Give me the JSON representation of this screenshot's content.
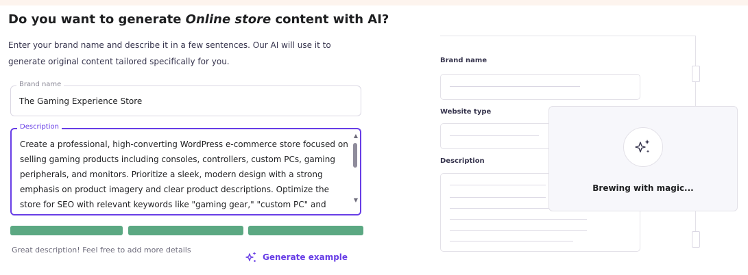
{
  "heading": {
    "prefix": "Do you want to generate ",
    "emphasis": "Online store",
    "suffix": " content with AI?"
  },
  "intro": "Enter your brand name and describe it in a few sentences. Our AI will use it to generate original content tailored specifically for you.",
  "form": {
    "brand": {
      "label": "Brand name",
      "value": "The Gaming Experience Store"
    },
    "description": {
      "label": "Description",
      "value": "Create a professional, high-converting WordPress e-commerce store focused on selling gaming products including consoles, controllers, custom PCs, gaming peripherals, and monitors. Prioritize a sleek, modern design with a strong emphasis on product imagery and clear product descriptions. Optimize the store for SEO with relevant keywords like \"gaming gear,\" \"custom PC\" and \"gaming accessories.\" Integrate a user-friendly shopping"
    },
    "quality_meter": {
      "filled_segments": 3,
      "total_segments": 3,
      "color": "#5ba882"
    },
    "hint": "Great description! Feel free to add more details",
    "generate_button": "Generate example",
    "accent_color": "#673de6"
  },
  "illustration": {
    "labels": {
      "brand": "Brand name",
      "website_type": "Website type",
      "description": "Description"
    },
    "status": "Brewing with magic...",
    "status_icon": "sparkles-icon"
  }
}
